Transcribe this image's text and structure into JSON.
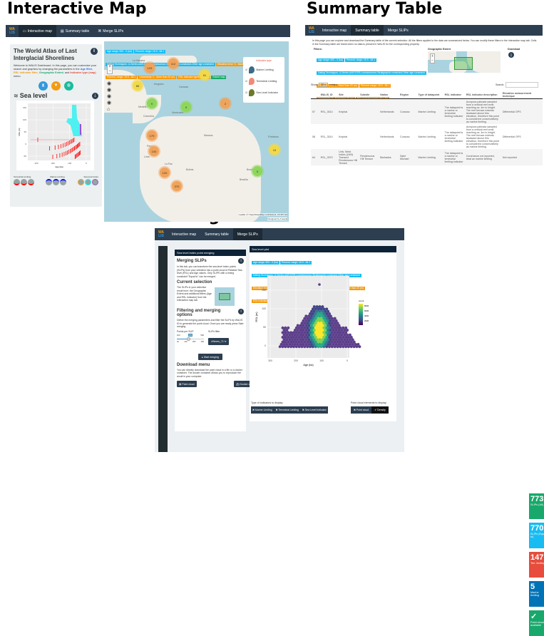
{
  "titles": {
    "interactive": "Interactive Map",
    "summary": "Summary Table",
    "merge": "Merge SLIPs"
  },
  "nav": {
    "logo_top": "WA",
    "logo_bottom": "LIS",
    "tabs": [
      "Interactive map",
      "Summary table",
      "Merge SLIPs"
    ]
  },
  "colors": {
    "navbar": "#2c3e50",
    "cyan": "#18bcf2",
    "orange": "#f39c12",
    "red": "#e74c3c",
    "green": "#18a86b",
    "blue": "#0073b7"
  },
  "interactive": {
    "card_title": "The World Atlas of Last Interglacial Shorelines",
    "welcome": "Welcome to WALIS Dashboard. In this page, you can customize your search and graphics by changing the parameters in the",
    "age_filter": "Age filter",
    "rsl_filter": "RSL indicator filter",
    "geo_extent": "Geographic Extent",
    "and": ", and",
    "indicator_type": "Indicator type (map)",
    "menu": "menu.",
    "sea_level": "Sea level",
    "plot": {
      "xlabel": "Age (ka)",
      "ylabel": "RSL (m)",
      "xticks": [
        "300",
        "200",
        "100",
        "0"
      ],
      "yticks": [
        "150",
        "100",
        "50",
        "0",
        "-50"
      ]
    },
    "legend_groups": [
      "Terrestrial Limiting",
      "Marine Limiting",
      "Sea level Index"
    ],
    "filter_tags": [
      {
        "text": "Age range: 500 - 0 (ka)",
        "c": "c"
      },
      {
        "text": "Percent. range: 15.9 - 84.1",
        "c": "c"
      },
      {
        "text": "Dating Techniques: U-Series-AAR-ESR-Luminescence-Stratigraphic constraint-Other age constraint",
        "c": "c"
      },
      {
        "text": "Elevation error: 0 - More than 20 (m)",
        "c": "o"
      },
      {
        "text": "Percent. range: 15.9 - 84.1",
        "c": "o"
      },
      {
        "text": "Uncertainty: 0 - More than 20 (m)",
        "c": "o"
      },
      {
        "text": "RSL Indicator types (30 / 30)",
        "c": "o"
      },
      {
        "text": "Extent map",
        "c": "g"
      }
    ],
    "indicator_legend": {
      "title": "Indicator type",
      "items": [
        "Marine Limiting",
        "Terrestrial Limiting",
        "Sea Level Indicator"
      ]
    },
    "clusters": [
      "129",
      "112",
      "81",
      "86",
      "9",
      "5",
      "2",
      "179",
      "100",
      "120",
      "370",
      "15",
      "5"
    ],
    "places": [
      "La Habana",
      "Kingston",
      "Caracas",
      "Medellín",
      "Colombia",
      "Venezuela",
      "Manaus",
      "Fortaleza",
      "Peru",
      "Lima",
      "La Paz",
      "Bolivia",
      "Brasil",
      "Brasília"
    ],
    "attribution": "Leaflet | © OpenStreetMap contributors, CC-BY-SA",
    "designed": "Designed by Freepik"
  },
  "summary": {
    "intro": "In this page you can explore and download the Summary table of the current selection. All the filters applied to the data are summarized below. You can modify these filters in the Interactive map tab. Cells in the Summary table are blank when no data is present in WALIS for the corresponding property.",
    "filters_label": "Filters:",
    "tags": [
      {
        "text": "Age range: 500 - 0 (ka)",
        "c": "c"
      },
      {
        "text": "Percent. range: 15.9 - 84.1",
        "c": "c"
      },
      {
        "text": "Dating Techniques: U-Series-AAR-ESR-Luminescence-Stratigraphic constraint-Other age constraint",
        "c": "c"
      },
      {
        "text": "Elevation error: 0 - More than 20 (m)",
        "c": "o"
      },
      {
        "text": "Percent. range: 15.9 - 84.1",
        "c": "o"
      },
      {
        "text": "Uncertainty: 0 - More than 20 (m)",
        "c": "o"
      },
      {
        "text": "RSL Indicator types (30 / 30)",
        "c": "o"
      },
      {
        "text": "Indicator types: Marine Limiting-Terrestrial Limiting-Sea Level Indicator",
        "c": "r"
      }
    ],
    "geo_label": "Geographic Extent",
    "download_label": "Download",
    "show": "Show",
    "entries_value": "25",
    "entries": "entries",
    "search": "Search:",
    "columns": [
      "",
      "WALIS_ID",
      "Site",
      "Subsite",
      "Nation",
      "Region",
      "Type of datapoint",
      "RSL indicator",
      "RSL indicator description",
      "Elevation measurement technique"
    ],
    "rows": [
      [
        "57",
        "RSL_3514",
        "Knipbai",
        "",
        "Netherlands",
        "Curacao",
        "Marine Limiting",
        "The datapoint is a marine or terrestrial limiting indicator",
        "Acropora palmata sampled from a vertical reef crest reaching ca. 4m in height. The reef terrace extends landward above this elevation, therefore this point is considered conservatively as marine limiting.",
        "Differential GPS"
      ],
      [
        "58",
        "RSL_3514",
        "Knipbai",
        "",
        "Netherlands",
        "Curacao",
        "Marine Limiting",
        "The datapoint is a marine or terrestrial limiting indicator",
        "Acropora palmata sampled from a vertical reef crest reaching ca. 4m in height. The reef terrace extends landward above this elevation, therefore this point is considered conservatively as marine limiting.",
        "Differential GPS"
      ],
      [
        "64",
        "RSL_3970",
        "Univ. West Indies (UWI) Transect Rendezvous Hill Terrace",
        "Rendezvous Hill Terrace",
        "Barbados",
        "Saint Michael",
        "Marine Limiting",
        "The datapoint is a marine or terrestrial limiting indicator",
        "Coral taxon not reported, treat as marine limiting",
        "Not reported"
      ]
    ]
  },
  "merge": {
    "box_title": "Sea level index point merging",
    "merging_title": "Merging SLIPs",
    "merging_text": "In this tab, you can transform the sea-level index points (SLIPs) from your selection into a point cloud of Relative Sea-level (RSL) and Age values. Only SLIPS with a timing constraint \"Equal to\" can be merged.",
    "current_title": "Current selection",
    "current_text": "The SLIPs in your selection result from: the Geographic Extent and additional filters (Age and RSL Indicator) from the Interactive map tab.",
    "filter_title": "Filtering and merging options",
    "filter_text": "Define the merging parameters and filter the SLIPs by WALIS ID to generate the point cloud. Once you are ready press Start merging",
    "points_label": "Points per SLIP",
    "slider": {
      "min": "100",
      "value": "250",
      "max": "500",
      "ticks": [
        "40",
        "130",
        "250",
        "400"
      ]
    },
    "slips_filter_label": "SLIPs filter",
    "slips_filter_value": "UNeres_71!",
    "start": "Start merging",
    "download_title": "Download menu",
    "download_text": "You can directly download the point cloud in a file or a docker container. The docker container allows you to reproduce the result in your computer.",
    "point_cloud_btn": "Point cloud",
    "docker_btn": "Docker container",
    "plot_title": "Sea level plot",
    "tags": [
      {
        "text": "Age range: 500 - 0 (ka)",
        "c": "c"
      },
      {
        "text": "Percent. range: 15.9 - 84.1",
        "c": "c"
      },
      {
        "text": "Dating Techniques: U-Series-AAR-ESR-Luminescence-Stratigraphic constraint-Other age constraint",
        "c": "c"
      },
      {
        "text": "Elevation error: 0 - More than 20 (m)",
        "c": "o"
      },
      {
        "text": "Percent. range: 15.9 - 84.1",
        "c": "o"
      },
      {
        "text": "Uncertainty: 0 - More than 20 (m)",
        "c": "o"
      },
      {
        "text": "RSL Indicator types (30 / 30)",
        "c": "o"
      }
    ],
    "plot": {
      "xlabel": "Age (ka)",
      "ylabel": "RSL (m)",
      "xticks": [
        "300",
        "200",
        "100",
        "0"
      ],
      "yticks": [
        "150",
        "100",
        "50",
        "0"
      ],
      "legend_title": "count",
      "legend_ticks": [
        "8000",
        "6000",
        "4000",
        "2000"
      ]
    },
    "value_boxes": [
      {
        "value": "773",
        "label": "SLIPs (All)",
        "color": "#18a86b"
      },
      {
        "value": "770",
        "label": "SLIPs (Equal to)",
        "color": "#18bcf2"
      },
      {
        "value": "147",
        "label": "Terr. limiting",
        "color": "#e74c3c"
      },
      {
        "value": "5",
        "label": "Marine limiting",
        "color": "#0073b7"
      },
      {
        "value": "✓",
        "label": "Point cloud available",
        "color": "#18a86b"
      }
    ],
    "indicators_label": "Type of indicators to display:",
    "indicators": [
      "Marine Limiting",
      "Terrestrial Limiting",
      "Sea Level Indicator"
    ],
    "cloud_label": "Point cloud elements to display:",
    "cloud": [
      "Point cloud",
      "Density"
    ]
  }
}
